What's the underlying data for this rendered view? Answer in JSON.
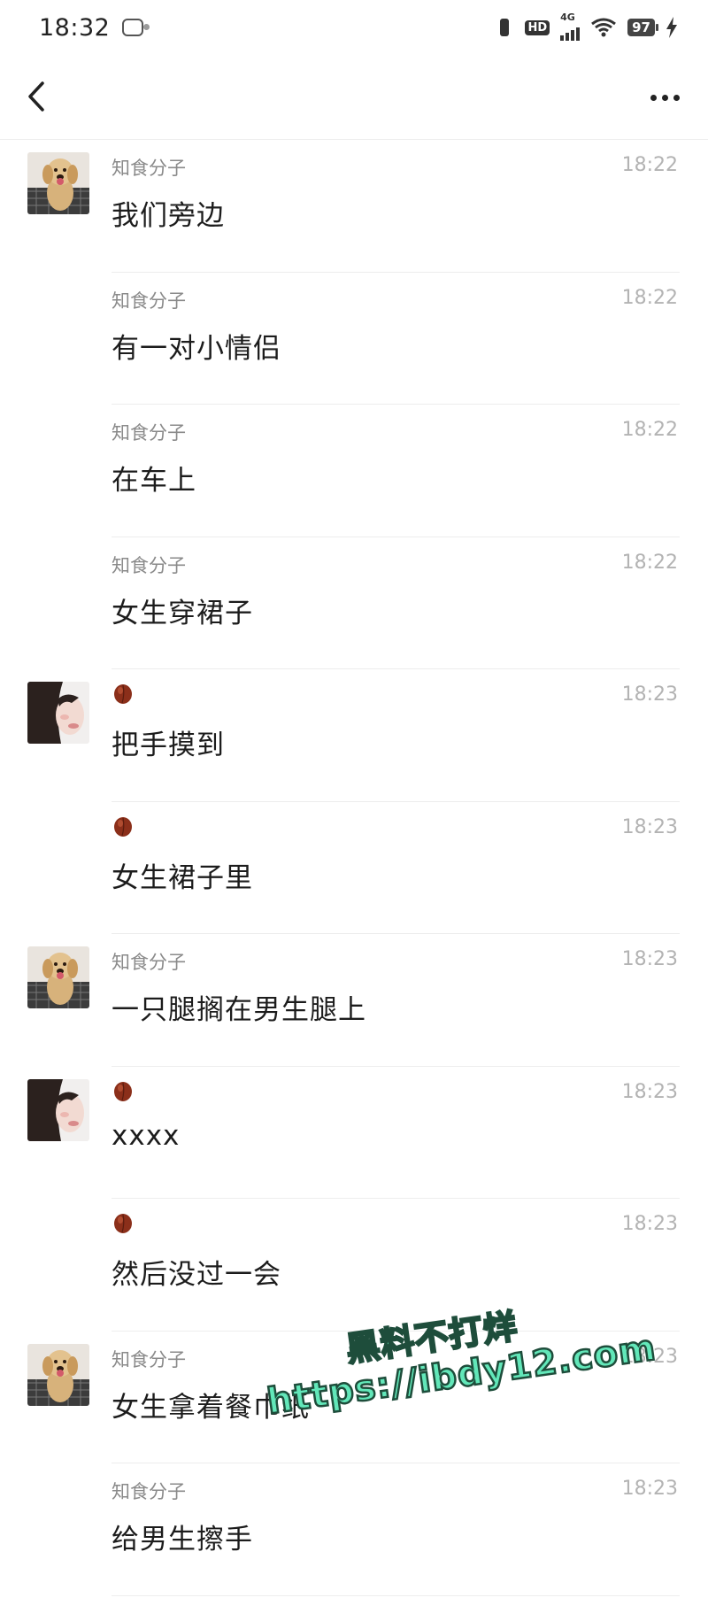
{
  "status_bar": {
    "time": "18:32",
    "network": "4G",
    "hd": "HD",
    "battery": "97"
  },
  "colors": {
    "dog_avatar": "#d7b27b",
    "girl_avatar": "#3a2e2a",
    "bean": "#8b2f1a",
    "watermark": "#62e7b9"
  },
  "messages": [
    {
      "avatar": "dog",
      "sender": "知食分子",
      "time": "18:22",
      "text": "我们旁边"
    },
    {
      "avatar": "",
      "sender": "知食分子",
      "time": "18:22",
      "text": "有一对小情侣"
    },
    {
      "avatar": "",
      "sender": "知食分子",
      "time": "18:22",
      "text": "在车上"
    },
    {
      "avatar": "",
      "sender": "知食分子",
      "time": "18:22",
      "text": "女生穿裙子"
    },
    {
      "avatar": "girl",
      "sender": "",
      "time": "18:23",
      "text": "把手摸到"
    },
    {
      "avatar": "",
      "sender": "",
      "time": "18:23",
      "text": "女生裙子里"
    },
    {
      "avatar": "dog",
      "sender": "知食分子",
      "time": "18:23",
      "text": "一只腿搁在男生腿上"
    },
    {
      "avatar": "girl",
      "sender": "",
      "time": "18:23",
      "text": "xxxx"
    },
    {
      "avatar": "",
      "sender": "",
      "time": "18:23",
      "text": "然后没过一会"
    },
    {
      "avatar": "dog",
      "sender": "知食分子",
      "time": "18:23",
      "text": "女生拿着餐巾纸"
    },
    {
      "avatar": "",
      "sender": "知食分子",
      "time": "18:23",
      "text": "给男生擦手"
    }
  ],
  "watermark": {
    "line1": "黑料不打烊",
    "line2": "https://ibdy12.com"
  }
}
